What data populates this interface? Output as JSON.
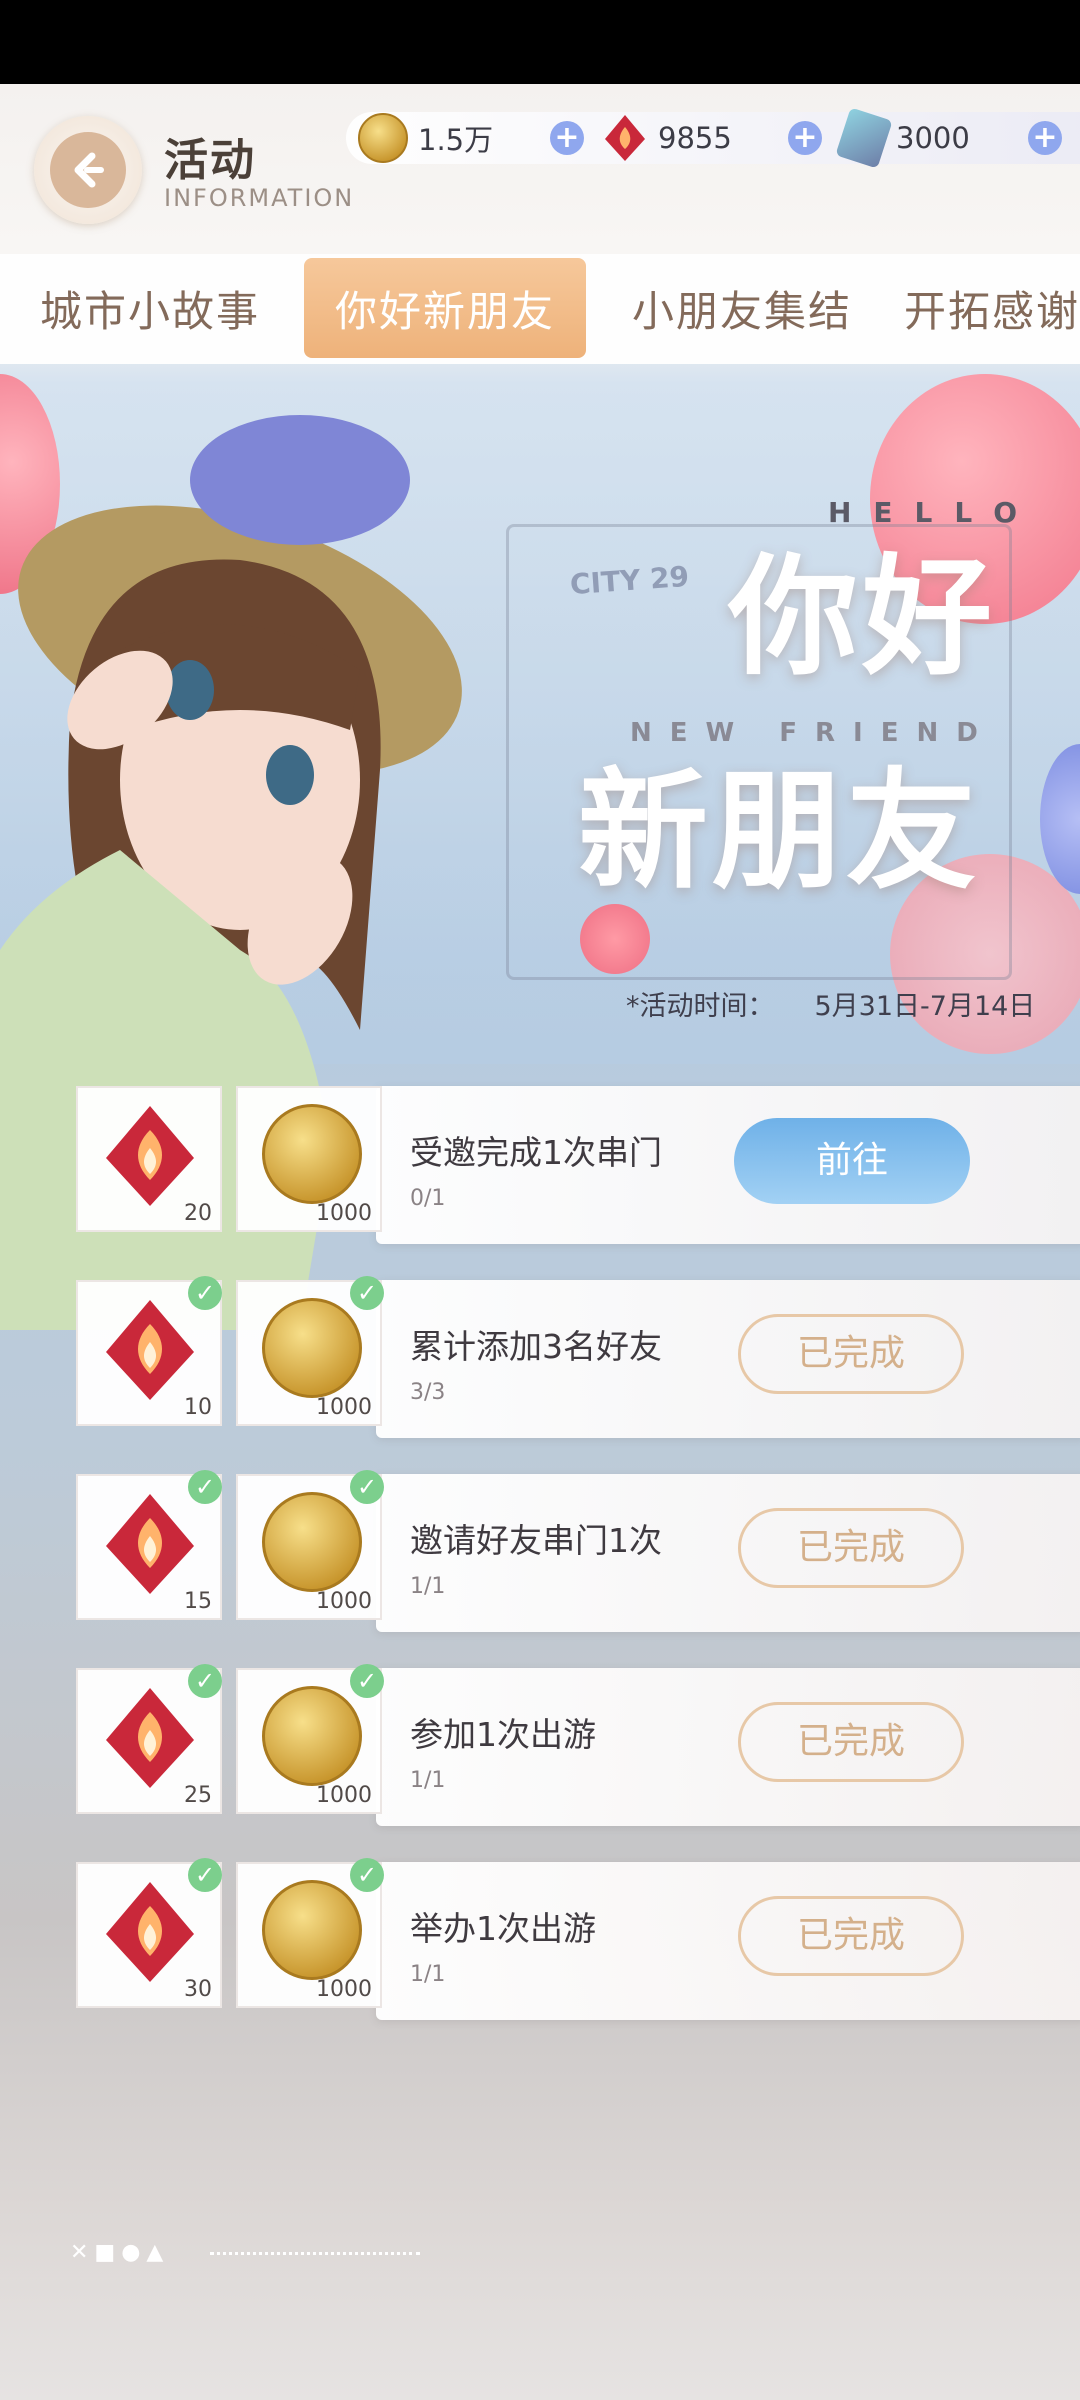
{
  "header": {
    "title": "活动",
    "subtitle": "INFORMATION"
  },
  "currencies": [
    {
      "icon": "gold-coin-icon",
      "value": "1.5万"
    },
    {
      "icon": "red-gem-icon",
      "value": "9855"
    },
    {
      "icon": "ticket-icon",
      "value": "3000"
    }
  ],
  "tabs": [
    {
      "label": "城市小故事",
      "active": false
    },
    {
      "label": "你好新朋友",
      "active": true
    },
    {
      "label": "小朋友集结",
      "active": false
    },
    {
      "label": "开拓感谢",
      "active": false
    }
  ],
  "banner": {
    "hello": "HELLO",
    "new_friend": "NEW FRIEND",
    "title_line1": "你好",
    "title_line2": "新朋友",
    "city_badge": "CITY 29",
    "time_label": "*活动时间：",
    "time_range": "5月31日-7月14日"
  },
  "tasks": [
    {
      "name": "受邀完成1次串门",
      "progress": "0/1",
      "gem": "20",
      "coin": "1000",
      "status": "前往",
      "done": false
    },
    {
      "name": "累计添加3名好友",
      "progress": "3/3",
      "gem": "10",
      "coin": "1000",
      "status": "已完成",
      "done": true
    },
    {
      "name": "邀请好友串门1次",
      "progress": "1/1",
      "gem": "15",
      "coin": "1000",
      "status": "已完成",
      "done": true
    },
    {
      "name": "参加1次出游",
      "progress": "1/1",
      "gem": "25",
      "coin": "1000",
      "status": "已完成",
      "done": true
    },
    {
      "name": "举办1次出游",
      "progress": "1/1",
      "gem": "30",
      "coin": "1000",
      "status": "已完成",
      "done": true
    }
  ],
  "footer": {
    "deco": "✕■●▲"
  },
  "colors": {
    "accent": "#eeb27a",
    "go_button": "#6fb1e8",
    "done_border": "#e7c8a7",
    "check": "#7ccf8d"
  }
}
